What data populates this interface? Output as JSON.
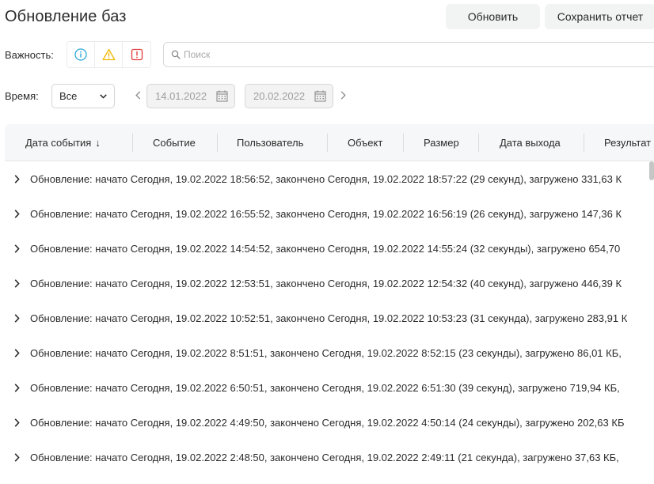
{
  "header": {
    "title": "Обновление баз",
    "refresh_label": "Обновить",
    "save_report_label": "Сохранить отчет"
  },
  "filters": {
    "severity_label": "Важность:",
    "severity_icons": [
      "info-icon",
      "warning-icon",
      "error-icon"
    ],
    "search_placeholder": "Поиск",
    "time_label": "Время:",
    "time_select_value": "Все",
    "date_from": "14.01.2022",
    "date_to": "20.02.2022"
  },
  "colors": {
    "info": "#2aa9d9",
    "warning": "#f2b705",
    "error": "#e23b3b"
  },
  "table": {
    "columns": [
      {
        "label": "Дата события",
        "sort": "↓"
      },
      {
        "label": "Событие"
      },
      {
        "label": "Пользователь"
      },
      {
        "label": "Объект"
      },
      {
        "label": "Размер"
      },
      {
        "label": "Дата выхода"
      },
      {
        "label": "Результат"
      }
    ],
    "rows": [
      "Обновление: начато Сегодня, 19.02.2022 18:56:52, закончено Сегодня, 19.02.2022 18:57:22 (29 секунд), загружено 331,63 К",
      "Обновление: начато Сегодня, 19.02.2022 16:55:52, закончено Сегодня, 19.02.2022 16:56:19 (26 секунд), загружено 147,36 К",
      "Обновление: начато Сегодня, 19.02.2022 14:54:52, закончено Сегодня, 19.02.2022 14:55:24 (32 секунды), загружено 654,70",
      "Обновление: начато Сегодня, 19.02.2022 12:53:51, закончено Сегодня, 19.02.2022 12:54:32 (40 секунд), загружено 446,39 К",
      "Обновление: начато Сегодня, 19.02.2022 10:52:51, закончено Сегодня, 19.02.2022 10:53:23 (31 секунда), загружено 283,91 К",
      "Обновление: начато Сегодня, 19.02.2022 8:51:51, закончено Сегодня, 19.02.2022 8:52:15 (23 секунды), загружено 86,01 КБ,",
      "Обновление: начато Сегодня, 19.02.2022 6:50:51, закончено Сегодня, 19.02.2022 6:51:30 (39 секунд), загружено 719,94 КБ,",
      "Обновление: начато Сегодня, 19.02.2022 4:49:50, закончено Сегодня, 19.02.2022 4:50:14 (24 секунды), загружено 202,63 КБ",
      "Обновление: начато Сегодня, 19.02.2022 2:48:50, закончено Сегодня, 19.02.2022 2:49:11 (21 секунда), загружено 37,63 КБ,"
    ]
  }
}
